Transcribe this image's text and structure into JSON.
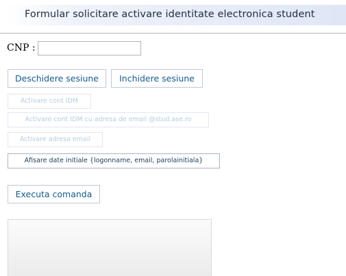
{
  "header": {
    "title": "Formular solicitare activare identitate electronica student"
  },
  "form": {
    "cnp_label": "CNP :",
    "cnp_value": "",
    "cnp_placeholder": ""
  },
  "session_buttons": {
    "open": "Deschidere sesiune",
    "close": "Inchidere sesiune"
  },
  "actions": [
    {
      "label": "Activare cont IDM",
      "enabled": false
    },
    {
      "label": "Activare cont IDM cu adresa de email @stud.ase.ro",
      "enabled": false
    },
    {
      "label": "Activare adresa email",
      "enabled": false
    },
    {
      "label": "Afisare date initiale {logonname, email, parolainitiala}",
      "enabled": true
    }
  ],
  "execute_button": "Executa comanda",
  "colors": {
    "button_text": "#145a8c",
    "button_disabled_text": "#b6cede",
    "title_text": "#1f2c3f"
  }
}
